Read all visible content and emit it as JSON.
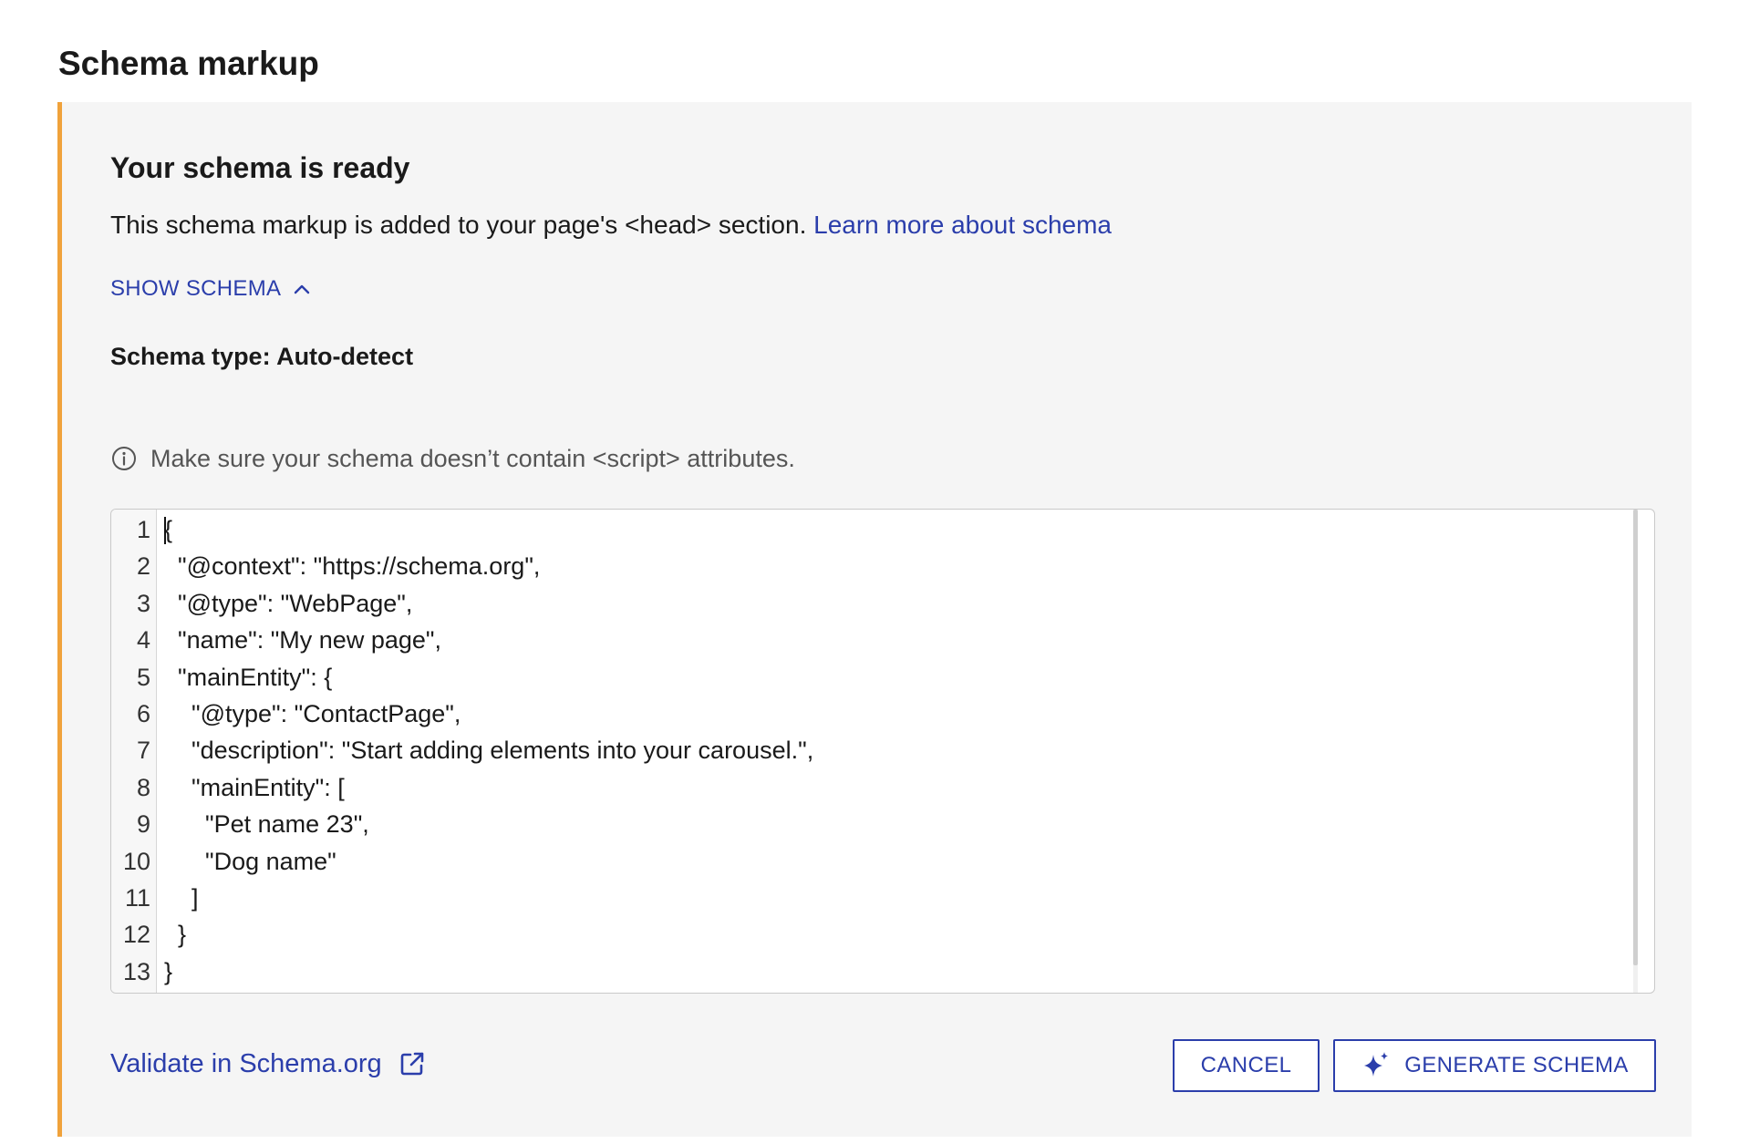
{
  "section": {
    "title": "Schema markup"
  },
  "panel": {
    "title": "Your schema is ready",
    "description": "This schema markup is added to your page's <head> section.",
    "learn_more_link": "Learn more about schema",
    "toggle_label": "SHOW SCHEMA",
    "toggle_icon": "chevron-up-icon",
    "schema_type_label": "Schema type: Auto-detect",
    "notice_text": "Make sure your schema doesn’t contain <script> attributes.",
    "notice_icon": "info-icon"
  },
  "editor": {
    "line_numbers": [
      "1",
      "2",
      "3",
      "4",
      "5",
      "6",
      "7",
      "8",
      "9",
      "10",
      "11",
      "12",
      "13"
    ],
    "lines": [
      "{",
      "  \"@context\": \"https://schema.org\",",
      "  \"@type\": \"WebPage\",",
      "  \"name\": \"My new page\",",
      "  \"mainEntity\": {",
      "    \"@type\": \"ContactPage\",",
      "    \"description\": \"Start adding elements into your carousel.\",",
      "    \"mainEntity\": [",
      "      \"Pet name 23\",",
      "      \"Dog name\"",
      "    ]",
      "  }",
      "}"
    ]
  },
  "footer": {
    "validate_link": "Validate in Schema.org",
    "validate_icon": "external-link-icon",
    "cancel_label": "CANCEL",
    "generate_label": "GENERATE SCHEMA",
    "generate_icon": "sparkle-icon"
  },
  "colors": {
    "accent": "#2b3eab",
    "panel_border": "#f0a23b",
    "panel_bg": "#f5f5f5"
  }
}
